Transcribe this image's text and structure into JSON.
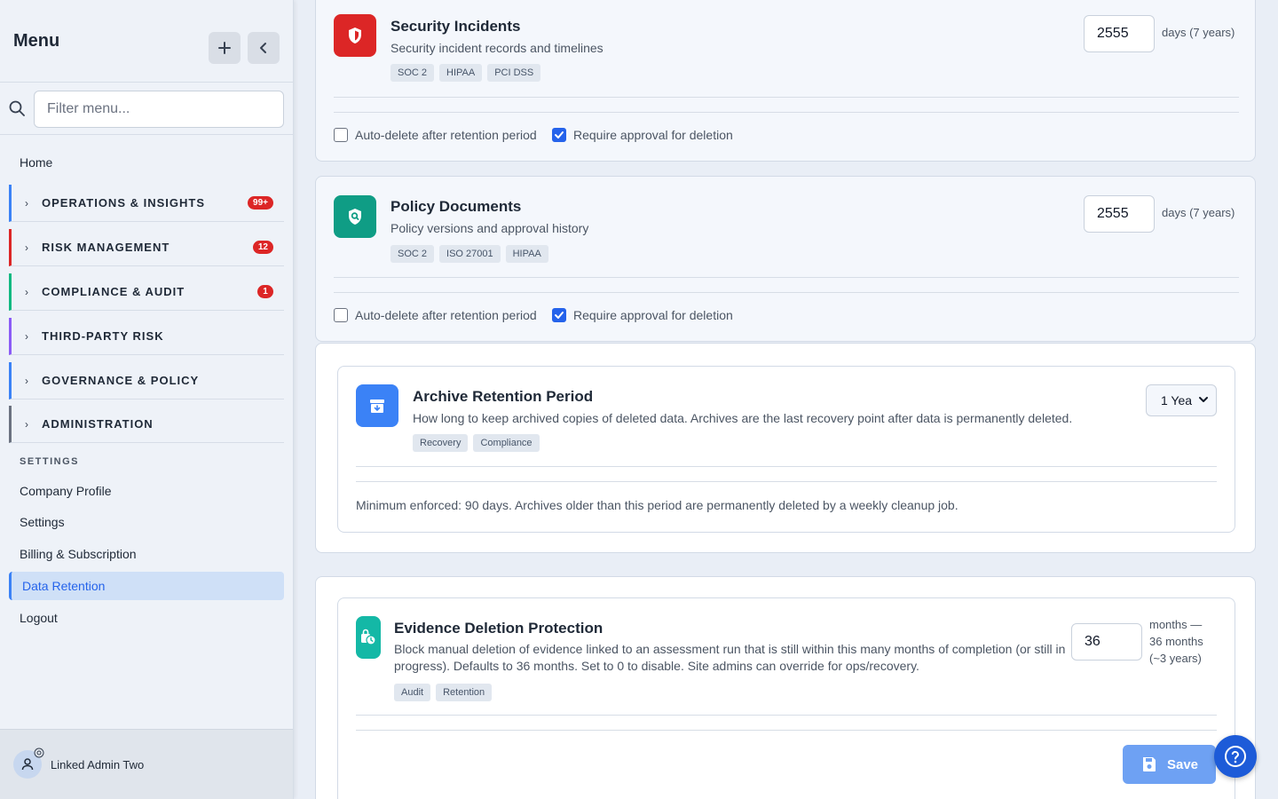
{
  "sidebar": {
    "title": "Menu",
    "filter_placeholder": "Filter menu...",
    "home": "Home",
    "groups": [
      {
        "label": "OPERATIONS & INSIGHTS",
        "badge": "99+",
        "color": "#3b82f6"
      },
      {
        "label": "RISK MANAGEMENT",
        "badge": "12",
        "color": "#dc2626"
      },
      {
        "label": "COMPLIANCE & AUDIT",
        "badge": "1",
        "color": "#10b981"
      },
      {
        "label": "THIRD-PARTY RISK",
        "badge": "",
        "color": "#8b5cf6"
      },
      {
        "label": "GOVERNANCE & POLICY",
        "badge": "",
        "color": "#3b82f6"
      },
      {
        "label": "ADMINISTRATION",
        "badge": "",
        "color": "#6b7280"
      }
    ],
    "settings_label": "SETTINGS",
    "settings_items": [
      "Company Profile",
      "Settings",
      "Billing & Subscription",
      "Data Retention",
      "Logout"
    ],
    "user_name": "Linked Admin Two"
  },
  "cards": {
    "security": {
      "title": "Security Incidents",
      "desc": "Security incident records and timelines",
      "tags": [
        "SOC 2",
        "HIPAA",
        "PCI DSS"
      ],
      "days": "2555",
      "unit": "days (7 years)",
      "auto_delete": "Auto-delete after retention period",
      "require_approval": "Require approval for deletion",
      "color": "#dc2626"
    },
    "policy": {
      "title": "Policy Documents",
      "desc": "Policy versions and approval history",
      "tags": [
        "SOC 2",
        "ISO 27001",
        "HIPAA"
      ],
      "days": "2555",
      "unit": "days (7 years)",
      "auto_delete": "Auto-delete after retention period",
      "require_approval": "Require approval for deletion",
      "color": "#0f9d85"
    },
    "archive": {
      "title": "Archive Retention Period",
      "desc": "How long to keep archived copies of deleted data. Archives are the last recovery point after data is permanently deleted.",
      "tags": [
        "Recovery",
        "Compliance"
      ],
      "selected": "1 Yea",
      "note": "Minimum enforced: 90 days. Archives older than this period are permanently deleted by a weekly cleanup job.",
      "color": "#3b82f6"
    },
    "evidence": {
      "title": "Evidence Deletion Protection",
      "desc": "Block manual deletion of evidence linked to an assessment run that is still within this many months of completion (or still in progress). Defaults to 36 months. Set to 0 to disable. Site admins can override for ops/recovery.",
      "tags": [
        "Audit",
        "Retention"
      ],
      "months": "36",
      "unit_1": "months —",
      "unit_2": "36 months",
      "unit_3": "(~3 years)",
      "color": "#14b8a6"
    }
  },
  "save_label": "Save"
}
